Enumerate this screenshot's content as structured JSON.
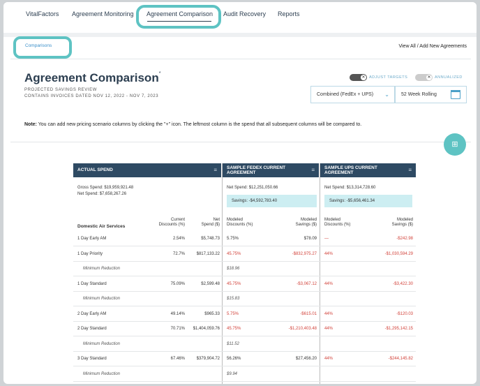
{
  "nav": {
    "items": [
      "VitalFactors",
      "Agreement Monitoring",
      "Agreement Comparison",
      "Audit Recovery",
      "Reports"
    ]
  },
  "breadcrumb": "Comparisons",
  "view_all": "View All / Add New Agreements",
  "page": {
    "title": "Agreement Comparison",
    "title_mark": "*",
    "subtitle1": "PROJECTED SAVINGS REVIEW",
    "subtitle2": "CONTAINS INVOICES DATED NOV 12, 2022 - NOV 7, 2023"
  },
  "toggles": {
    "adjust_label": "ADJUST TARGETS",
    "annualized_label": "ANNUALIZED",
    "knob_mark": "✕"
  },
  "filters": {
    "carrier": "Combined (FedEx + UPS)",
    "period": "52 Week Rolling"
  },
  "note": {
    "label": "Note:",
    "text": "You can add new pricing scenario columns by clicking the \"+\" icon. The leftmost column is the spend that all subsequent columns will be compared to."
  },
  "add_button": "⊞",
  "columns": [
    {
      "title_1": "ACTUAL SPEND",
      "title_2": ""
    },
    {
      "title_1": "SAMPLE FEDEX CURRENT",
      "title_2": "AGREEMENT"
    },
    {
      "title_1": "SAMPLE UPS CURRENT",
      "title_2": "AGREEMENT"
    }
  ],
  "menu_icon": "≡",
  "summary": {
    "gross": "Gross Spend: $19,959,921.48",
    "net": "Net Spend: $7,658,267.26",
    "fedex_net": "Net Spend: $12,251,050.66",
    "fedex_savings": "Savings: -$4,592,783.40",
    "ups_net": "Net Spend: $13,314,728.60",
    "ups_savings": "Savings: -$5,656,461.34"
  },
  "table_headers": {
    "service": "Domestic Air Services",
    "current_disc_1": "Current",
    "current_disc_2": "Discounts (%)",
    "net_1": "Net",
    "net_2": "Spend ($)",
    "fx_disc_1": "Modeled",
    "fx_disc_2": "Discounts (%)",
    "fx_sav_1": "Modeled",
    "fx_sav_2": "Savings ($)",
    "ups_disc_1": "Modeled",
    "ups_disc_2": "Discounts (%)",
    "ups_sav_1": "Modeled",
    "ups_sav_2": "Savings ($)"
  },
  "rows": [
    {
      "service": "1 Day Early AM",
      "cur": "2.54%",
      "net": "$5,748.73",
      "fx_d": "5.75%",
      "fx_s": "$78.09",
      "ups_d": "—",
      "ups_s": "-$242.98",
      "fx_d_red": false,
      "fx_s_red": false,
      "ups_d_red": true,
      "ups_s_red": true
    },
    {
      "service": "1 Day Priority",
      "cur": "72.7%",
      "net": "$817,133.22",
      "fx_d": "45.75%",
      "fx_s": "-$832,975.27",
      "ups_d": "44%",
      "ups_s": "-$1,030,594.29",
      "fx_d_red": true,
      "fx_s_red": true,
      "ups_d_red": true,
      "ups_s_red": true
    },
    {
      "service": "Minimum Reduction",
      "minimum": true,
      "fx_d": "$18.96"
    },
    {
      "service": "1 Day Standard",
      "cur": "75.09%",
      "net": "$2,599.48",
      "fx_d": "45.75%",
      "fx_s": "-$3,067.12",
      "ups_d": "44%",
      "ups_s": "-$3,422.30",
      "fx_d_red": true,
      "fx_s_red": true,
      "ups_d_red": true,
      "ups_s_red": true
    },
    {
      "service": "Minimum Reduction",
      "minimum": true,
      "fx_d": "$15.83"
    },
    {
      "service": "2 Day Early AM",
      "cur": "49.14%",
      "net": "$965.33",
      "fx_d": "5.75%",
      "fx_s": "-$615.01",
      "ups_d": "44%",
      "ups_s": "-$120.03",
      "fx_d_red": true,
      "fx_s_red": true,
      "ups_d_red": true,
      "ups_s_red": true
    },
    {
      "service": "2 Day Standard",
      "cur": "70.71%",
      "net": "$1,404,059.76",
      "fx_d": "45.75%",
      "fx_s": "-$1,210,403.48",
      "ups_d": "44%",
      "ups_s": "-$1,295,142.15",
      "fx_d_red": true,
      "fx_s_red": true,
      "ups_d_red": true,
      "ups_s_red": true
    },
    {
      "service": "Minimum Reduction",
      "minimum": true,
      "fx_d": "$11.52"
    },
    {
      "service": "3 Day Standard",
      "cur": "67.46%",
      "net": "$379,904.72",
      "fx_d": "56.26%",
      "fx_s": "$27,456.20",
      "ups_d": "44%",
      "ups_s": "-$244,145.82",
      "fx_d_red": false,
      "fx_s_red": false,
      "ups_d_red": true,
      "ups_s_red": true
    },
    {
      "service": "Minimum Reduction",
      "minimum": true,
      "fx_d": "$9.94"
    }
  ],
  "colors": {
    "accent": "#5ec3c3",
    "header": "#2e4a63",
    "negative": "#d2423a"
  }
}
